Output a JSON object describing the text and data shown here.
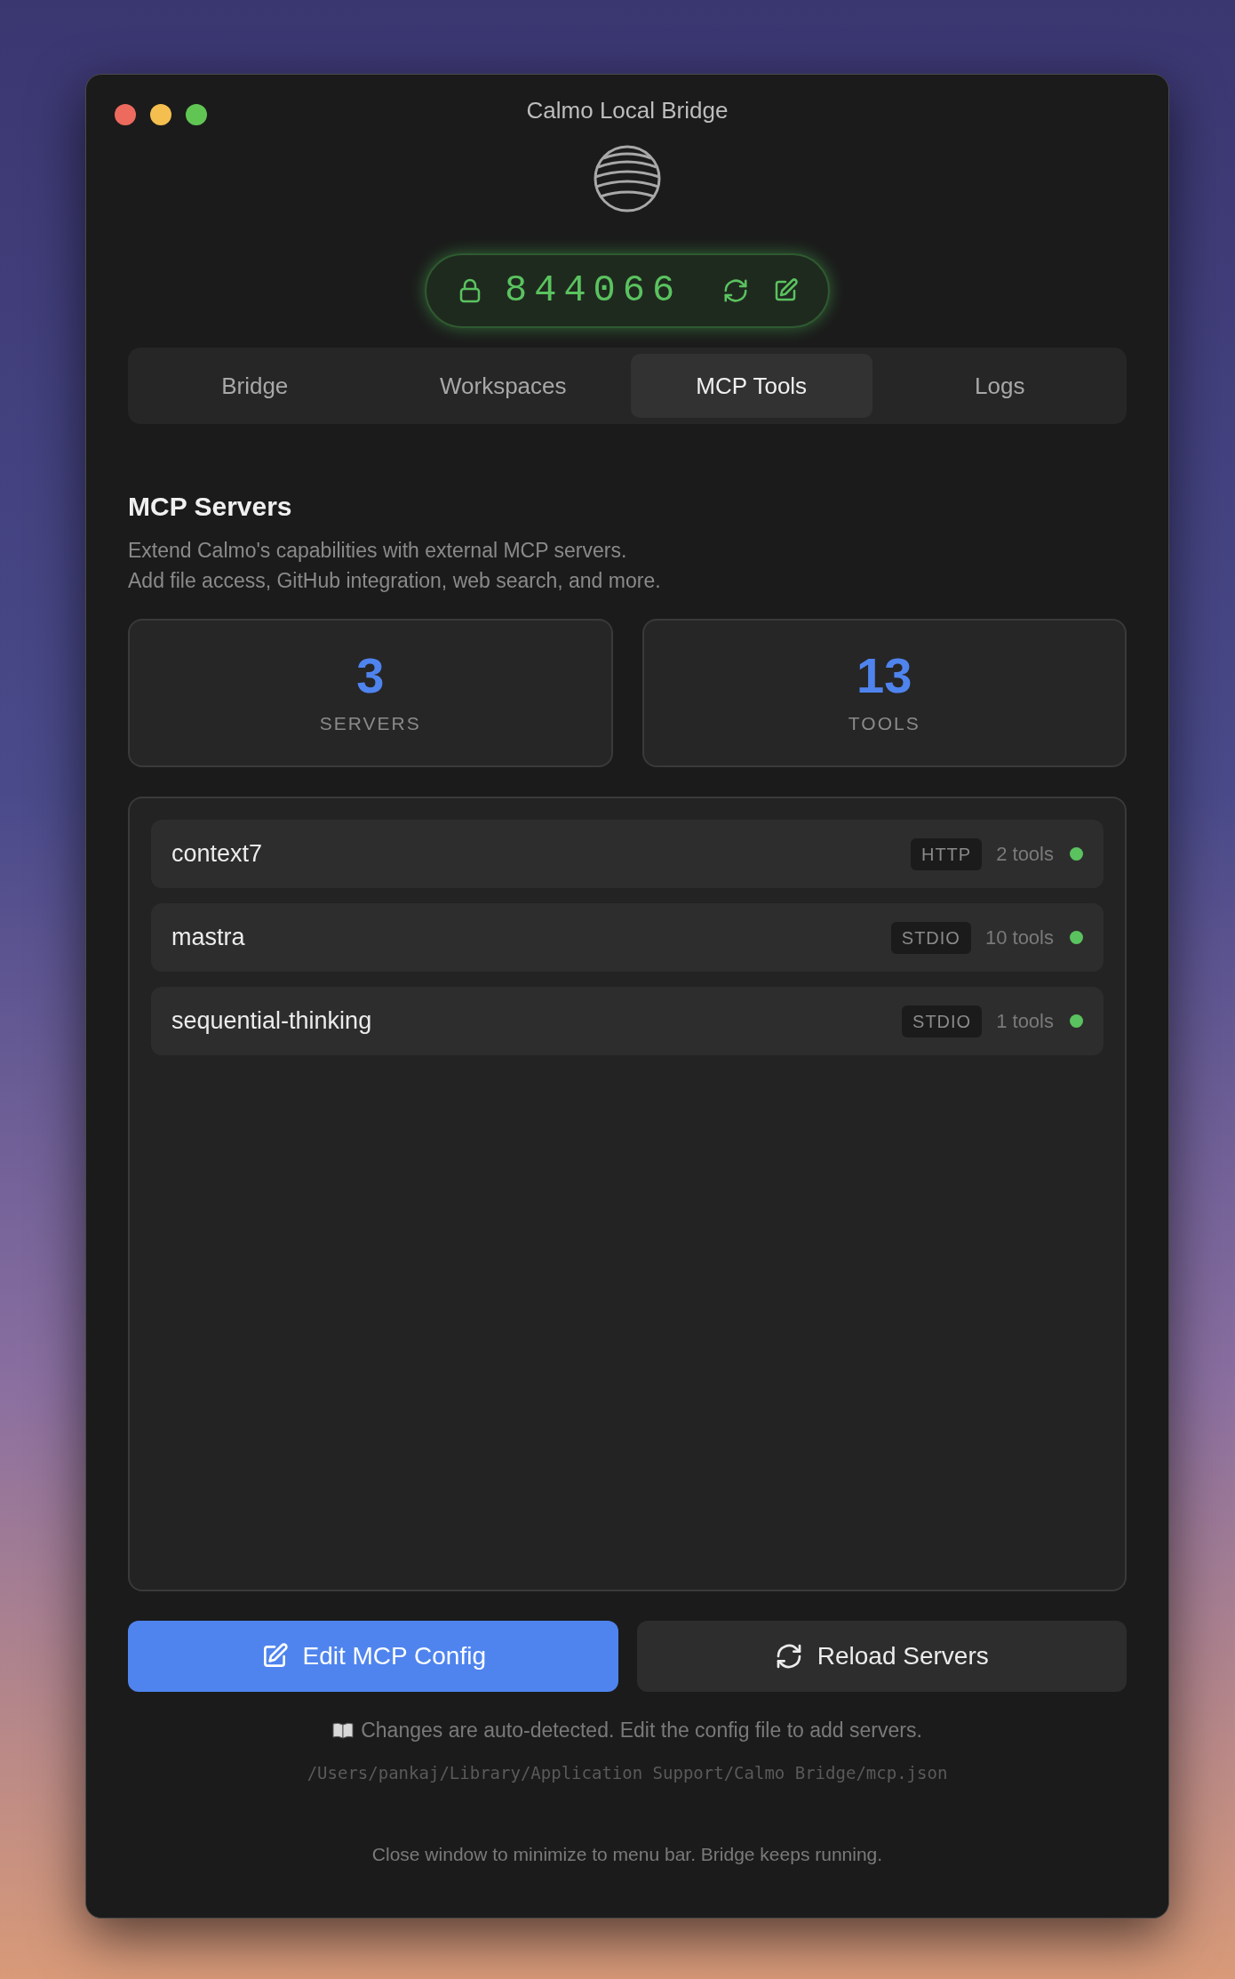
{
  "window": {
    "title": "Calmo Local Bridge"
  },
  "pairing": {
    "code": "844066"
  },
  "tabs": [
    {
      "label": "Bridge",
      "selected": false
    },
    {
      "label": "Workspaces",
      "selected": false
    },
    {
      "label": "MCP Tools",
      "selected": true
    },
    {
      "label": "Logs",
      "selected": false
    }
  ],
  "section": {
    "title": "MCP Servers",
    "description": [
      "Extend Calmo's capabilities with external MCP servers.",
      "Add file access, GitHub integration, web search, and more."
    ]
  },
  "stats": [
    {
      "value": "3",
      "label": "SERVERS"
    },
    {
      "value": "13",
      "label": "TOOLS"
    }
  ],
  "servers": [
    {
      "name": "context7",
      "transport": "HTTP",
      "tools": "2 tools",
      "color": "#5ac35f"
    },
    {
      "name": "mastra",
      "transport": "STDIO",
      "tools": "10 tools",
      "color": "#5ac35f"
    },
    {
      "name": "sequential-thinking",
      "transport": "STDIO",
      "tools": "1 tools",
      "color": "#5ac35f"
    }
  ],
  "buttons": [
    {
      "kind": "primary",
      "label": "Edit MCP Config"
    },
    {
      "kind": "secondary",
      "label": "Reload Servers"
    }
  ],
  "hint": "Changes are auto-detected. Edit the config file to add servers.",
  "config_path": "/Users/pankaj/Library/Application Support/Calmo Bridge/mcp.json",
  "footer": "Close window to minimize to menu bar. Bridge keeps running."
}
